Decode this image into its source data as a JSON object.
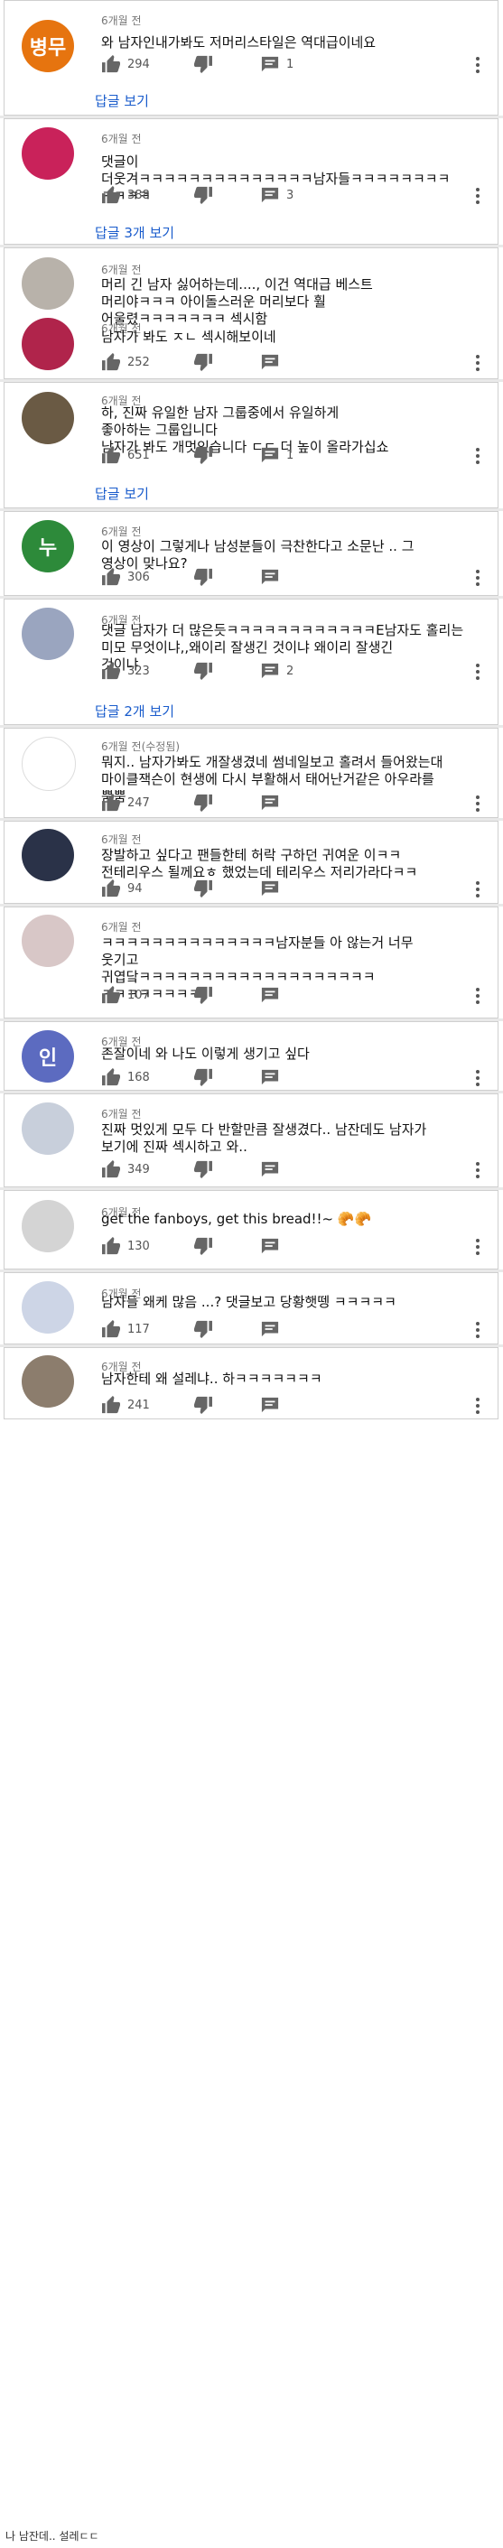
{
  "comments": [
    {
      "author": "",
      "time": "6개월 전",
      "avatar_text": "병무",
      "avatar_color": "#e6740f",
      "text": "와 남자인내가봐도 저머리스타일은 역대급이네요",
      "likes": "294",
      "replies": "1",
      "reply_link": "답글 보기"
    },
    {
      "author": "",
      "time": "6개월 전",
      "avatar_text": "",
      "avatar_color": "#c9225a",
      "text": "댓글이\n더웃겨ㅋㅋㅋㅋㅋㅋㅋㅋㅋㅋㅋㅋㅋㅋ남자들ㅋㅋㅋㅋㅋㅋㅋㅋ\nㅋㅋㅋㅋ",
      "likes": "388",
      "replies": "3",
      "reply_link": "답글 3개 보기"
    },
    {
      "author": "",
      "time": "6개월 전",
      "avatar_text": "",
      "avatar_color": "#b8b2aa",
      "text": "머리 긴 남자 싫어하는데...., 이건 역대급 베스트\n머리야ㅋㅋㅋ 아이돌스러운 머리보다 훨\n어울렸ㅋㅋㅋㅋㅋㅋㅋ 섹시함",
      "likes": "",
      "replies": "",
      "reply_link": ""
    },
    {
      "author": "",
      "time": "6개월 전",
      "avatar_text": "",
      "avatar_color": "#b0244b",
      "text": "남자가 봐도 ㅈㄴ 섹시해보이네",
      "likes": "252",
      "replies": "",
      "reply_link": ""
    },
    {
      "author": "",
      "time": "6개월 전",
      "avatar_text": "",
      "avatar_color": "#6a5a44",
      "text": "하, 진짜 유일한 남자 그룹중에서 유일하게\n좋아하는 그룹입니다\n남자가 봐도 개멋있습니다 ㄷㄷ 더 높이 올라가십쇼",
      "likes": "651",
      "replies": "1",
      "reply_link": "답글 보기"
    },
    {
      "author": "",
      "time": "6개월 전",
      "avatar_text": "누",
      "avatar_color": "#2d8a3a",
      "text": "이 영상이 그렇게나 남성분들이 극찬한다고 소문난 .. 그\n영상이 맞나요?",
      "likes": "306",
      "replies": "",
      "reply_link": ""
    },
    {
      "author": "",
      "time": "6개월 전",
      "avatar_text": "",
      "avatar_color": "#9aa5bf",
      "text": "댓글 남자가 더 많은듯ㅋㅋㅋㅋㅋㅋㅋㅋㅋㅋㅋㅋE남자도 홀리는\n미모 무엇이냐,,왜이리 잘생긴 것이냐 왜이리 잘생긴\n것이냐",
      "likes": "323",
      "replies": "2",
      "reply_link": "답글 2개 보기"
    },
    {
      "author": "",
      "time": "6개월 전(수정됨)",
      "avatar_text": "",
      "avatar_color": "#ffffff",
      "text": "뭐지.. 남자가봐도 개잘생겼네 썸네일보고 홀려서 들어왔는대\n마이클잭슨이 현생에 다시 부활해서 태어난거같은 아우라를\n뿜뿜",
      "likes": "247",
      "replies": "",
      "reply_link": ""
    },
    {
      "author": "",
      "time": "6개월 전",
      "avatar_text": "",
      "avatar_color": "#2a3248",
      "text": "장발하고 싶다고 팬들한테 허락 구하던 귀여운 이ㅋㅋ\n전테리우스 될께요ㅎ 했었는데 테리우스 저리가라다ㅋㅋ",
      "likes": "94",
      "replies": "",
      "reply_link": ""
    },
    {
      "author": "",
      "time": "6개월 전",
      "avatar_text": "",
      "avatar_color": "#d8c7c7",
      "text": "ㅋㅋㅋㅋㅋㅋㅋㅋㅋㅋㅋㅋㅋㅋ남자분들 아 않는거 너무\n웃기고\n귀엽닼ㅋㅋㅋㅋㅋㅋㅋㅋㅋㅋㅋㅋㅋㅋㅋㅋㅋㅋㅋ\nㅋㅋㅋㅋㅋㅋㅋㅋ",
      "likes": "107",
      "replies": "",
      "reply_link": ""
    },
    {
      "author": "",
      "time": "6개월 전",
      "avatar_text": "인",
      "avatar_color": "#5c6bc0",
      "text": "존잘이네 와 나도 이렇게 생기고 싶다",
      "likes": "168",
      "replies": "",
      "reply_link": ""
    },
    {
      "author": "",
      "time": "6개월 전",
      "avatar_text": "",
      "avatar_color": "#c8cfdb",
      "text": "진짜 멋있게 모두 다 반할만큼 잘생겼다.. 남잔데도 남자가\n보기에 진짜 섹시하고 와..",
      "likes": "349",
      "replies": "",
      "reply_link": ""
    },
    {
      "author": "",
      "time": "6개월 전",
      "avatar_text": "",
      "avatar_color": "#d4d4d4",
      "text": "get the fanboys, get this bread!!~ 🥐🥐",
      "likes": "130",
      "replies": "",
      "reply_link": ""
    },
    {
      "author": "",
      "time": "6개월 전",
      "avatar_text": "",
      "avatar_color": "#cdd5e6",
      "text": "남자들 왜케 많음 ...? 댓글보고 당황햇뗑 ㅋㅋㅋㅋㅋ",
      "likes": "117",
      "replies": "",
      "reply_link": ""
    },
    {
      "author": "",
      "time": "6개월 전",
      "avatar_text": "",
      "avatar_color": "#8c7d6d",
      "text": "남자한테 왜 설레냐.. 하ㅋㅋㅋㅋㅋㅋㅋ",
      "likes": "241",
      "replies": "",
      "reply_link": ""
    }
  ],
  "footer_text": "나 남잔데.. 설레ㄷㄷ"
}
